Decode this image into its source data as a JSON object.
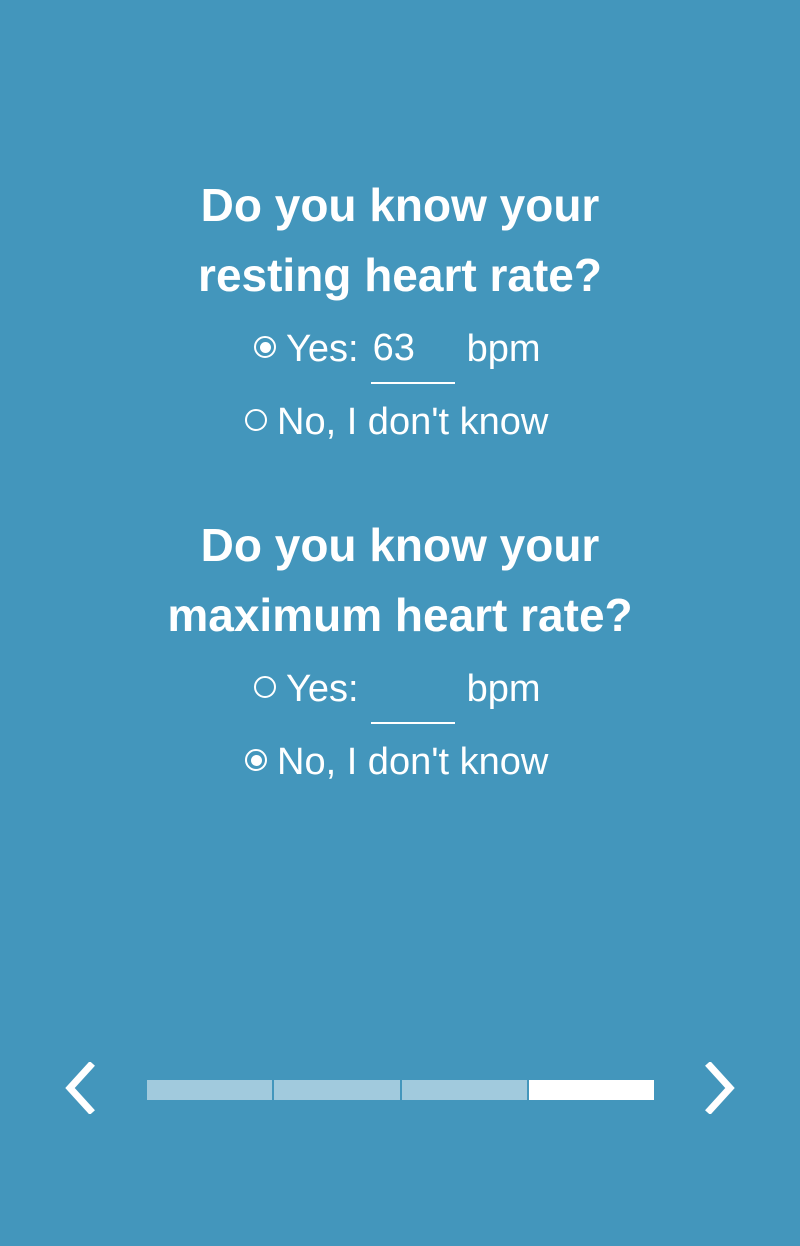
{
  "questions": [
    {
      "title_line1": "Do you know your",
      "title_line2": "resting heart rate?",
      "yes_label": "Yes:",
      "yes_value": "63",
      "unit": "bpm",
      "no_label": "No, I don't know",
      "selected": "yes"
    },
    {
      "title_line1": "Do you know your",
      "title_line2": "maximum heart rate?",
      "yes_label": "Yes:",
      "yes_value": "",
      "unit": "bpm",
      "no_label": "No, I don't know",
      "selected": "no"
    }
  ],
  "navigation": {
    "prev_icon": "chevron-left-icon",
    "next_icon": "chevron-right-icon"
  },
  "progress": {
    "total_steps": 4,
    "current_step": 4
  },
  "colors": {
    "background": "#4396bc",
    "progress_inactive": "#a1cadd",
    "progress_active": "#ffffff",
    "text": "#ffffff"
  }
}
